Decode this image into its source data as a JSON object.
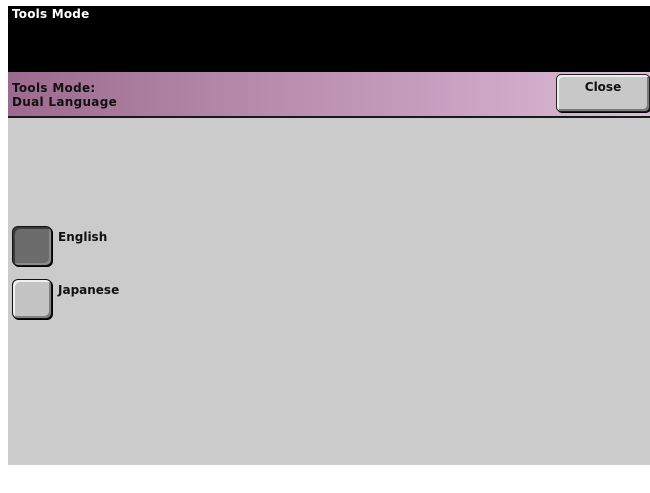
{
  "window": {
    "title": "Tools Mode"
  },
  "header": {
    "line1": "Tools Mode:",
    "line2": "Dual Language",
    "close_label": "Close"
  },
  "language_options": [
    {
      "label": "English",
      "selected": true
    },
    {
      "label": "Japanese",
      "selected": false
    }
  ],
  "colors": {
    "title_bar": "#000000",
    "header_gradient_start": "#9c6a8e",
    "header_gradient_end": "#dcbcd6",
    "panel_background": "#cbcbcb",
    "selected_button": "#6c6c6c",
    "unselected_button": "#c4c4c4"
  }
}
